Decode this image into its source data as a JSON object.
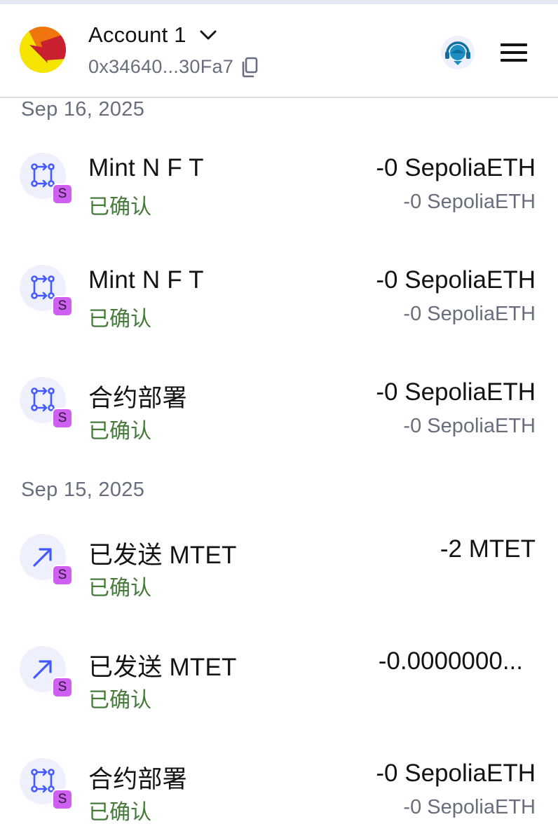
{
  "header": {
    "account_name": "Account 1",
    "address": "0x34640...30Fa7",
    "avatar_icon": "account-avatar-jazzicon",
    "support_icon": "support-agent-icon",
    "menu_icon": "hamburger-menu-icon"
  },
  "activity": [
    {
      "date": "Sep 16, 2025",
      "items": [
        {
          "icon": "contract-interaction-icon",
          "network_badge": "S",
          "title": "Mint N F T",
          "status": "已确认",
          "amount": "-0 SepoliaETH",
          "secondary": "-0 SepoliaETH"
        },
        {
          "icon": "contract-interaction-icon",
          "network_badge": "S",
          "title": "Mint N F T",
          "status": "已确认",
          "amount": "-0 SepoliaETH",
          "secondary": "-0 SepoliaETH"
        },
        {
          "icon": "contract-interaction-icon",
          "network_badge": "S",
          "title": "合约部署",
          "status": "已确认",
          "amount": "-0 SepoliaETH",
          "secondary": "-0 SepoliaETH"
        }
      ]
    },
    {
      "date": "Sep 15, 2025",
      "items": [
        {
          "icon": "send-arrow-icon",
          "network_badge": "S",
          "title": "已发送 MTET",
          "status": "已确认",
          "amount": "-2 MTET",
          "secondary": ""
        },
        {
          "icon": "send-arrow-icon",
          "network_badge": "S",
          "title": "已发送 MTET",
          "status": "已确认",
          "amount": "-0.0000000...",
          "secondary": ""
        },
        {
          "icon": "contract-interaction-icon",
          "network_badge": "S",
          "title": "合约部署",
          "status": "已确认",
          "amount": "-0 SepoliaETH",
          "secondary": "-0 SepoliaETH"
        }
      ]
    }
  ],
  "colors": {
    "status_confirmed": "#457a39",
    "network_badge": "#cf5ff0",
    "icon_circle": "#eef0fc",
    "icon_stroke": "#4459ff",
    "muted_text": "#686e7d"
  }
}
